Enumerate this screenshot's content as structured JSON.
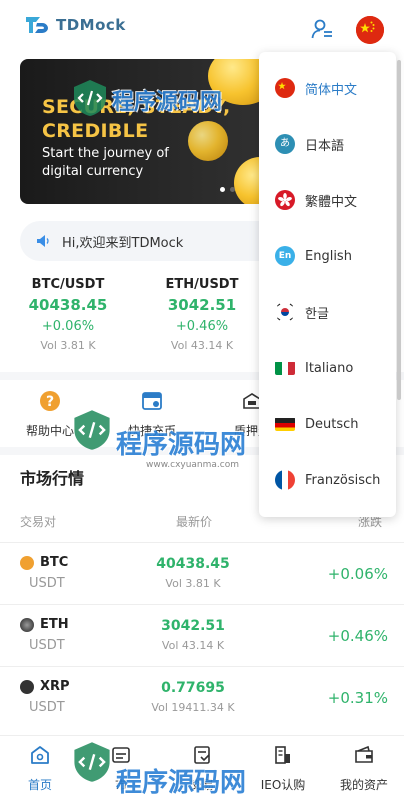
{
  "app": {
    "name": "TDMock"
  },
  "banner": {
    "title": "SECURE, STEADY,\nCREDIBLE",
    "subtitle": "Start the journey of\ndigital currency"
  },
  "notice": {
    "text": "Hi,欢迎来到TDMock"
  },
  "tickers": [
    {
      "pair": "BTC/USDT",
      "price": "40438.45",
      "change": "+0.06%",
      "volume": "Vol 3.81 K"
    },
    {
      "pair": "ETH/USDT",
      "price": "3042.51",
      "change": "+0.46%",
      "volume": "Vol 43.14 K"
    }
  ],
  "quick_menu": [
    {
      "label": "帮助中心",
      "icon": "help-icon"
    },
    {
      "label": "快捷充币",
      "icon": "deposit-icon"
    },
    {
      "label": "质押生",
      "icon": "staking-icon"
    }
  ],
  "market": {
    "title": "市场行情",
    "headers": {
      "pair": "交易对",
      "price": "最新价",
      "change": "涨跌"
    },
    "rows": [
      {
        "base": "BTC",
        "quote": "USDT",
        "price": "40438.45",
        "volume": "Vol 3.81 K",
        "change": "+0.06%",
        "icon_color": "#f7931a"
      },
      {
        "base": "ETH",
        "quote": "USDT",
        "price": "3042.51",
        "volume": "Vol 43.14 K",
        "change": "+0.46%",
        "icon_color": "#555555"
      },
      {
        "base": "XRP",
        "quote": "USDT",
        "price": "0.77695",
        "volume": "Vol 19411.34 K",
        "change": "+0.31%",
        "icon_color": "#333333"
      }
    ]
  },
  "nav": [
    {
      "label": "首页",
      "icon": "home-icon",
      "active": true
    },
    {
      "label": "市",
      "icon": "market-icon",
      "active": false
    },
    {
      "label": "交易",
      "icon": "trade-icon",
      "active": false
    },
    {
      "label": "IEO认购",
      "icon": "ieo-icon",
      "active": false
    },
    {
      "label": "我的资产",
      "icon": "wallet-icon",
      "active": false
    }
  ],
  "languages": [
    {
      "label": "简体中文",
      "flag": "china-flag-icon",
      "active": true
    },
    {
      "label": "日本語",
      "flag": "japan-flag-icon",
      "badge": "あ"
    },
    {
      "label": "繁體中文",
      "flag": "hongkong-flag-icon"
    },
    {
      "label": "English",
      "flag": "english-flag-icon",
      "badge": "En"
    },
    {
      "label": "한글",
      "flag": "korea-flag-icon"
    },
    {
      "label": "Italiano",
      "flag": "italy-flag-icon"
    },
    {
      "label": "Deutsch",
      "flag": "germany-flag-icon"
    },
    {
      "label": "Französisch",
      "flag": "france-flag-icon"
    }
  ],
  "watermark": {
    "text": "程序源码网",
    "url": "www.cxyuanma.com"
  },
  "colors": {
    "accent": "#2b7cc7",
    "up": "#2fb36b",
    "brand": "#3b6f93",
    "banner_gold": "#f6c445"
  }
}
